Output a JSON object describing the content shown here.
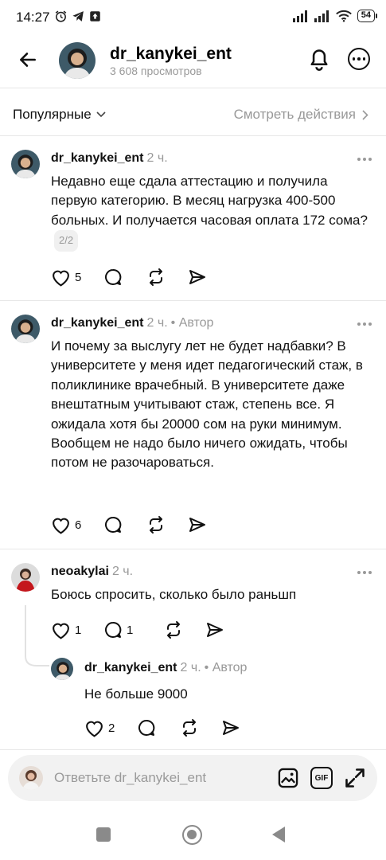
{
  "status_bar": {
    "time": "14:27",
    "battery": "54"
  },
  "header": {
    "username": "dr_kanykei_ent",
    "views": "3 608 просмотров"
  },
  "filter": {
    "sort_label": "Популярные",
    "activity_label": "Смотреть действия"
  },
  "comments": [
    {
      "user": "dr_kanykei_ent",
      "time": "2 ч.",
      "author_tag": "",
      "text": "Недавно еще сдала аттестацию и получила первую категорию. В месяц нагрузка 400-500 больных. И получается часовая оплата 172 сома?",
      "pager": "2/2",
      "likes": "5",
      "replies": ""
    },
    {
      "user": "dr_kanykei_ent",
      "time": "2 ч.",
      "author_tag": "• Автор",
      "text": "И почему за выслугу лет не будет надбавки? В университете у меня идет педагогический стаж, в поликлинике врачебный. В университете даже внештатным учитывают стаж, степень все. Я ожидала хотя бы 20000 сом на руки минимум. Вообщем не надо было ничего ожидать, чтобы потом не разочароваться.",
      "likes": "6",
      "replies": ""
    },
    {
      "user": "neoakylai",
      "time": "2 ч.",
      "author_tag": "",
      "text": "Боюсь спросить, сколько было раньшп",
      "likes": "1",
      "replies": "1"
    },
    {
      "user": "dr_kanykei_ent",
      "time": "2 ч.",
      "author_tag": "• Автор",
      "text": "Не больше 9000",
      "likes": "2",
      "replies": ""
    }
  ],
  "reply_box": {
    "placeholder": "Ответьте dr_kanykei_ent",
    "gif_label": "GIF"
  },
  "icons": {
    "back": "arrow-left-icon",
    "notifications": "bell-icon",
    "more": "more-icon",
    "like": "heart-icon",
    "reply": "comment-icon",
    "repost": "repost-icon",
    "share": "send-icon",
    "image": "image-icon",
    "gif": "gif-icon",
    "expand": "expand-icon"
  }
}
